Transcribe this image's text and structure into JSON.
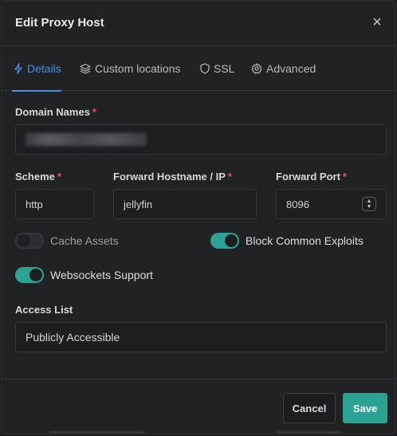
{
  "modal": {
    "title": "Edit Proxy Host",
    "close_icon": "×"
  },
  "tabs": [
    {
      "label": "Details",
      "icon": "bolt-icon",
      "active": true
    },
    {
      "label": "Custom locations",
      "icon": "layers-icon",
      "active": false
    },
    {
      "label": "SSL",
      "icon": "shield-icon",
      "active": false
    },
    {
      "label": "Advanced",
      "icon": "gear-icon",
      "active": false
    }
  ],
  "form": {
    "domain_names": {
      "label": "Domain Names",
      "required": "*"
    },
    "scheme": {
      "label": "Scheme",
      "required": "*",
      "value": "http"
    },
    "forward_host": {
      "label": "Forward Hostname / IP",
      "required": "*",
      "value": "jellyfin"
    },
    "forward_port": {
      "label": "Forward Port",
      "required": "*",
      "value": "8096"
    },
    "cache_assets": {
      "label": "Cache Assets",
      "enabled": false
    },
    "block_exploits": {
      "label": "Block Common Exploits",
      "enabled": true
    },
    "websockets": {
      "label": "Websockets Support",
      "enabled": true
    },
    "access_list": {
      "label": "Access List",
      "value": "Publicly Accessible"
    }
  },
  "footer": {
    "cancel_label": "Cancel",
    "save_label": "Save"
  },
  "colors": {
    "accent": "#4a90e2",
    "toggle_on": "#2aa392",
    "required": "#e55353",
    "save": "#2aa392"
  }
}
